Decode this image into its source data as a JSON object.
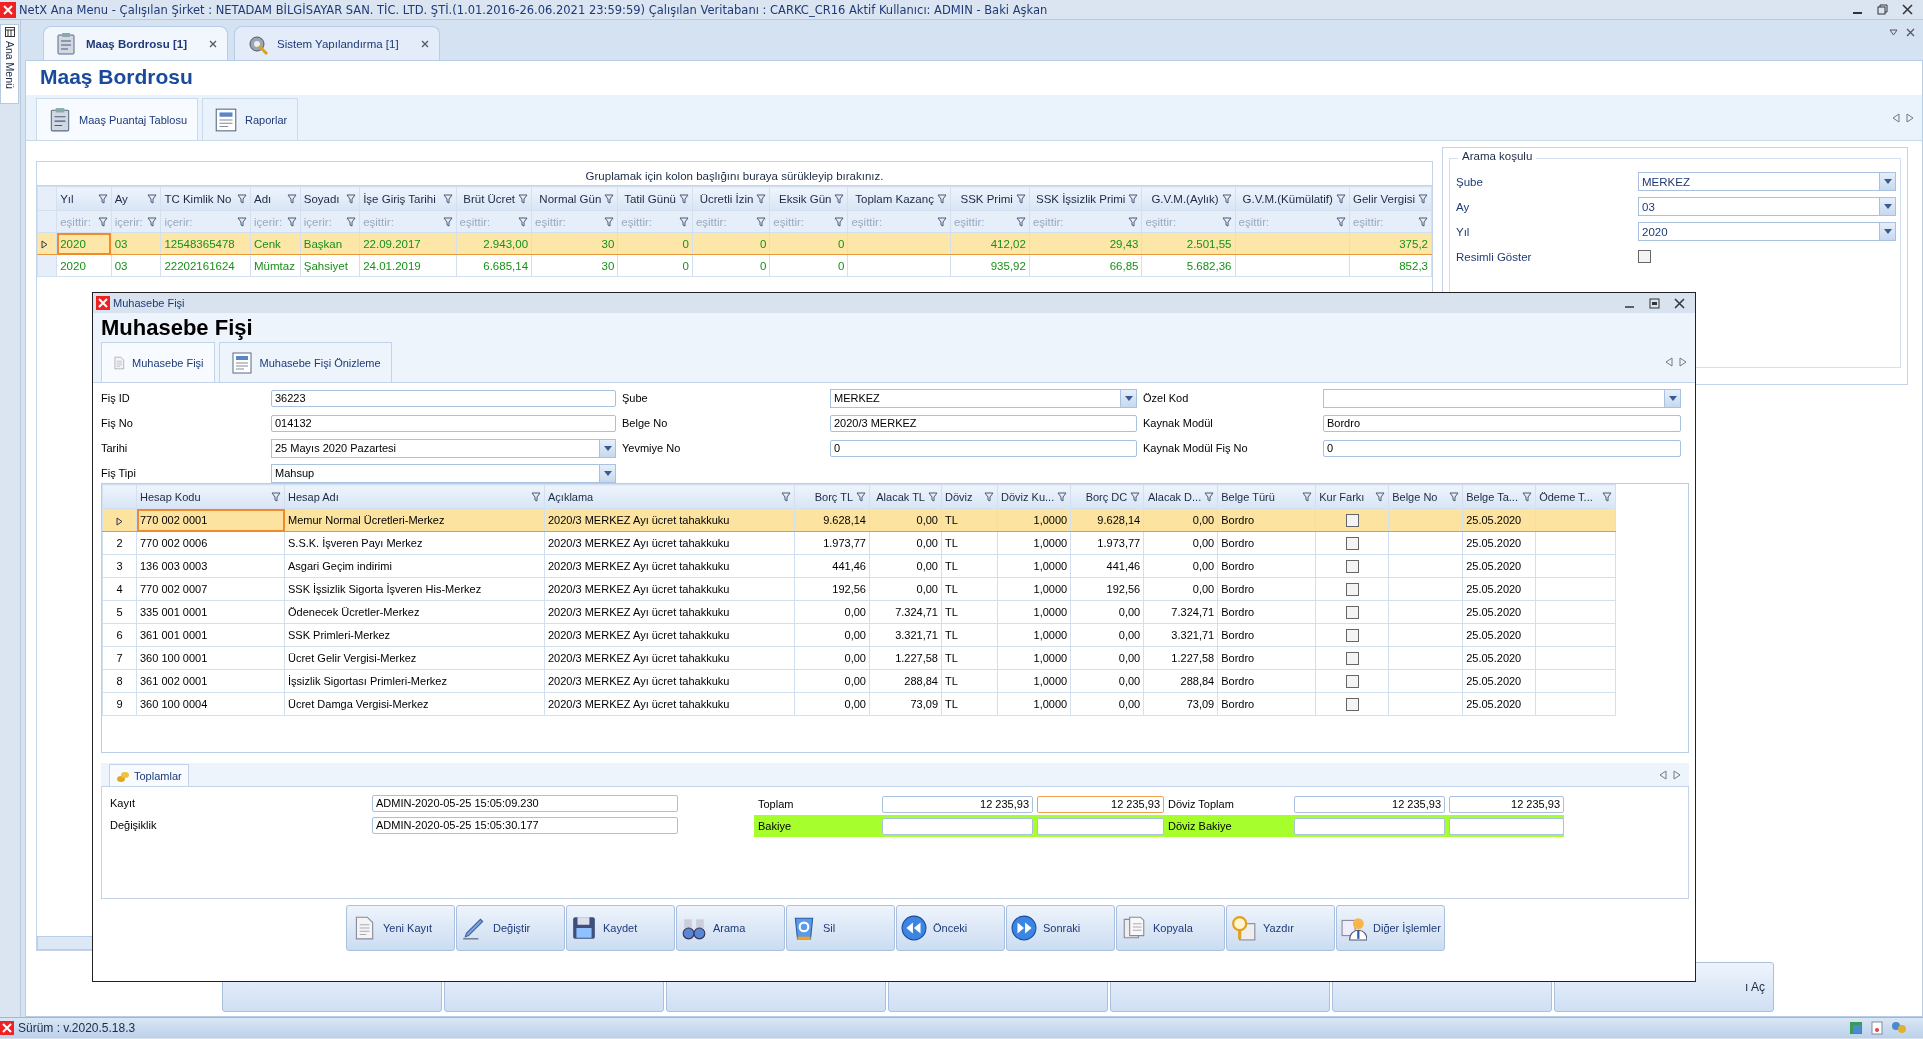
{
  "window": {
    "title": "NetX Ana Menu - Çalışılan Şirket : NETADAM BİLGİSAYAR SAN. TİC. LTD. ŞTİ.(1.01.2016-26.06.2021 23:59:59) Çalışılan Veritabanı : CARKC_CR16  Aktif Kullanıcı: ADMIN - Baki Aşkan"
  },
  "side_panel": {
    "label": "Ana Menü"
  },
  "doc_tabs": [
    {
      "label": "Maaş Bordrosu [1]",
      "selected": true
    },
    {
      "label": "Sistem Yapılandırma [1]",
      "selected": false
    }
  ],
  "page_title": "Maaş Bordrosu",
  "page_tabs": [
    {
      "label": "Maaş Puantaj Tablosu",
      "selected": true
    },
    {
      "label": "Raporlar",
      "selected": false
    }
  ],
  "payroll_grid": {
    "group_hint": "Gruplamak için kolon başlığını buraya sürükleyip bırakınız.",
    "columns": [
      {
        "label": "Yıl",
        "filter": "eşittir:",
        "kind": "text"
      },
      {
        "label": "Ay",
        "filter": "içerir:",
        "kind": "text"
      },
      {
        "label": "TC Kimlik No",
        "filter": "içerir:",
        "kind": "text"
      },
      {
        "label": "Adı",
        "filter": "içerir:",
        "kind": "text"
      },
      {
        "label": "Soyadı",
        "filter": "içerir:",
        "kind": "text"
      },
      {
        "label": "İşe Giriş Tarihi",
        "filter": "eşittir:",
        "kind": "text"
      },
      {
        "label": "Brüt Ücret",
        "filter": "eşittir:",
        "kind": "number"
      },
      {
        "label": "Normal Gün",
        "filter": "eşittir:",
        "kind": "number"
      },
      {
        "label": "Tatil Günü",
        "filter": "eşittir:",
        "kind": "number"
      },
      {
        "label": "Ücretli İzin",
        "filter": "eşittir:",
        "kind": "number"
      },
      {
        "label": "Eksik Gün",
        "filter": "eşittir:",
        "kind": "number"
      },
      {
        "label": "Toplam Kazanç",
        "filter": "eşittir:",
        "kind": "number"
      },
      {
        "label": "SSK Primi",
        "filter": "eşittir:",
        "kind": "number"
      },
      {
        "label": "SSK İşsizlik Primi",
        "filter": "eşittir:",
        "kind": "number"
      },
      {
        "label": "G.V.M.(Aylık)",
        "filter": "eşittir:",
        "kind": "number"
      },
      {
        "label": "G.V.M.(Kümülatif)",
        "filter": "eşittir:",
        "kind": "number"
      },
      {
        "label": "Gelir Vergisi",
        "filter": "eşittir:",
        "kind": "number"
      }
    ],
    "rows": [
      {
        "selected": true,
        "cells": [
          "2020",
          "03",
          "12548365478",
          "Cenk",
          "Başkan",
          "22.09.2017",
          "2.943,00",
          "30",
          "0",
          "0",
          "0",
          null,
          "412,02",
          "29,43",
          "2.501,55",
          null,
          "375,2"
        ]
      },
      {
        "selected": false,
        "cells": [
          "2020",
          "03",
          "22202161624",
          "Mümtaz",
          "Şahsiyet",
          "24.01.2019",
          "6.685,14",
          "30",
          "0",
          "0",
          "0",
          null,
          "935,92",
          "66,85",
          "5.682,36",
          null,
          "852,3"
        ]
      }
    ]
  },
  "search_panel": {
    "legend": "Arama koşulu",
    "fields": [
      {
        "kind": "combo",
        "label": "Şube",
        "value": "MERKEZ"
      },
      {
        "kind": "combo",
        "label": "Ay",
        "value": "03"
      },
      {
        "kind": "combo",
        "label": "Yıl",
        "value": "2020"
      },
      {
        "kind": "checkbox",
        "label": "Resimli Göster",
        "checked": false
      }
    ]
  },
  "hidden_button": {
    "label": "ı Aç"
  },
  "dialog": {
    "title": "Muhasebe Fişi",
    "heading": "Muhasebe Fişi",
    "tabs": [
      {
        "label": "Muhasebe Fişi",
        "selected": true
      },
      {
        "label": "Muhasebe Fişi Önizleme",
        "selected": false
      }
    ],
    "form": [
      [
        {
          "kind": "text",
          "label": "Fiş ID",
          "value": "36223"
        },
        {
          "kind": "text",
          "label": "Fiş No",
          "value": "014132"
        },
        {
          "kind": "combo",
          "label": "Tarihi",
          "value": "25 Mayıs 2020 Pazartesi"
        },
        {
          "kind": "combo",
          "label": "Fiş Tipi",
          "value": "Mahsup"
        }
      ],
      [
        {
          "kind": "combo",
          "label": "Şube",
          "value": "MERKEZ"
        },
        {
          "kind": "text",
          "label": "Belge No",
          "value": "2020/3 MERKEZ"
        },
        {
          "kind": "text",
          "label": "Yevmiye No",
          "value": "0"
        }
      ],
      [
        {
          "kind": "combo",
          "label": "Özel Kod"
        },
        {
          "kind": "text",
          "label": "Kaynak Modül",
          "value": "Bordro"
        },
        {
          "kind": "text",
          "label": "Kaynak Modül Fiş No",
          "value": "0"
        }
      ]
    ],
    "entries": {
      "columns": [
        {
          "label": "Hesap Kodu",
          "kind": "text"
        },
        {
          "label": "Hesap Adı",
          "kind": "text"
        },
        {
          "label": "Açıklama",
          "kind": "text"
        },
        {
          "label": "Borç TL",
          "kind": "number"
        },
        {
          "label": "Alacak TL",
          "kind": "number"
        },
        {
          "label": "Döviz",
          "kind": "text"
        },
        {
          "label": "Döviz Ku...",
          "kind": "number"
        },
        {
          "label": "Borç DC",
          "kind": "number"
        },
        {
          "label": "Alacak D...",
          "kind": "number"
        },
        {
          "label": "Belge Türü",
          "kind": "text"
        },
        {
          "label": "Kur Farkı",
          "kind": "check"
        },
        {
          "label": "Belge No",
          "kind": "text"
        },
        {
          "label": "Belge Ta...",
          "kind": "text"
        },
        {
          "label": "Ödeme T...",
          "kind": "text"
        }
      ],
      "rows": [
        {
          "selected": true,
          "cells": [
            "770 002 0001",
            "Memur Normal Ücretleri-Merkez",
            "2020/3 MERKEZ Ayı ücret tahakkuku",
            "9.628,14",
            "0,00",
            "TL",
            "1,0000",
            "9.628,14",
            "0,00",
            "Bordro",
            false,
            null,
            "25.05.2020",
            null
          ]
        },
        {
          "selected": false,
          "number": "2",
          "cells": [
            "770 002 0006",
            "S.S.K. İşveren Payı Merkez",
            "2020/3 MERKEZ Ayı ücret tahakkuku",
            "1.973,77",
            "0,00",
            "TL",
            "1,0000",
            "1.973,77",
            "0,00",
            "Bordro",
            false,
            null,
            "25.05.2020",
            null
          ]
        },
        {
          "selected": false,
          "number": "3",
          "cells": [
            "136 003 0003",
            "Asgari Geçim indirimi",
            "2020/3 MERKEZ Ayı ücret tahakkuku",
            "441,46",
            "0,00",
            "TL",
            "1,0000",
            "441,46",
            "0,00",
            "Bordro",
            false,
            null,
            "25.05.2020",
            null
          ]
        },
        {
          "selected": false,
          "number": "4",
          "cells": [
            "770 002 0007",
            "SSK İşsizlik Sigorta İşveren His-Merkez",
            "2020/3 MERKEZ Ayı ücret tahakkuku",
            "192,56",
            "0,00",
            "TL",
            "1,0000",
            "192,56",
            "0,00",
            "Bordro",
            false,
            null,
            "25.05.2020",
            null
          ]
        },
        {
          "selected": false,
          "number": "5",
          "cells": [
            "335 001 0001",
            "Ödenecek Ücretler-Merkez",
            "2020/3 MERKEZ Ayı ücret tahakkuku",
            "0,00",
            "7.324,71",
            "TL",
            "1,0000",
            "0,00",
            "7.324,71",
            "Bordro",
            false,
            null,
            "25.05.2020",
            null
          ]
        },
        {
          "selected": false,
          "number": "6",
          "cells": [
            "361 001 0001",
            "SSK Primleri-Merkez",
            "2020/3 MERKEZ Ayı ücret tahakkuku",
            "0,00",
            "3.321,71",
            "TL",
            "1,0000",
            "0,00",
            "3.321,71",
            "Bordro",
            false,
            null,
            "25.05.2020",
            null
          ]
        },
        {
          "selected": false,
          "number": "7",
          "cells": [
            "360 100 0001",
            "Ücret Gelir Vergisi-Merkez",
            "2020/3 MERKEZ Ayı ücret tahakkuku",
            "0,00",
            "1.227,58",
            "TL",
            "1,0000",
            "0,00",
            "1.227,58",
            "Bordro",
            false,
            null,
            "25.05.2020",
            null
          ]
        },
        {
          "selected": false,
          "number": "8",
          "cells": [
            "361 002 0001",
            "İşsizlik Sigortası Primleri-Merkez",
            "2020/3 MERKEZ Ayı ücret tahakkuku",
            "0,00",
            "288,84",
            "TL",
            "1,0000",
            "0,00",
            "288,84",
            "Bordro",
            false,
            null,
            "25.05.2020",
            null
          ]
        },
        {
          "selected": false,
          "number": "9",
          "cells": [
            "360 100 0004",
            "Ücret Damga Vergisi-Merkez",
            "2020/3 MERKEZ Ayı ücret tahakkuku",
            "0,00",
            "73,09",
            "TL",
            "1,0000",
            "0,00",
            "73,09",
            "Bordro",
            false,
            null,
            "25.05.2020",
            null
          ]
        }
      ]
    },
    "totals": {
      "tab": "Toplamlar",
      "audit": [
        {
          "label": "Kayıt",
          "value": "ADMIN-2020-05-25 15:05:09.230"
        },
        {
          "label": "Değişiklik",
          "value": "ADMIN-2020-05-25 15:05:30.177"
        }
      ],
      "sums": [
        {
          "label": "Toplam",
          "values": [
            "12 235,93",
            "12 235,93"
          ],
          "focus": [
            false,
            true
          ],
          "fx_label": "Döviz Toplam",
          "fx_values": [
            "12 235,93",
            "12 235,93"
          ],
          "highlight": false
        },
        {
          "label": "Bakiye",
          "focus": [
            false,
            false
          ],
          "fx_label": "Döviz Bakiye",
          "highlight": true
        }
      ]
    },
    "buttons": [
      {
        "label": "Yeni Kayıt"
      },
      {
        "label": "Değiştir"
      },
      {
        "label": "Kaydet"
      },
      {
        "label": "Arama"
      },
      {
        "label": "Sil"
      },
      {
        "label": "Önceki"
      },
      {
        "label": "Sonraki"
      },
      {
        "label": "Kopyala"
      },
      {
        "label": "Yazdır"
      },
      {
        "label": "Diğer İşlemler"
      }
    ]
  },
  "status_bar": {
    "version": "Sürüm : v.2020.5.18.3"
  }
}
